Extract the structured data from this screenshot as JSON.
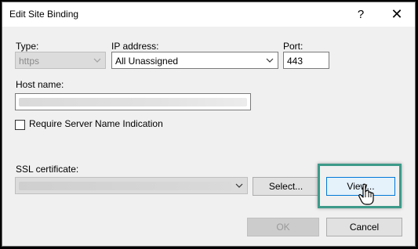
{
  "dialog": {
    "title": "Edit Site Binding",
    "help_label": "?",
    "close_label": "✕"
  },
  "type": {
    "label": "Type:",
    "value": "https"
  },
  "ip": {
    "label": "IP address:",
    "value": "All Unassigned"
  },
  "port": {
    "label": "Port:",
    "value": "443"
  },
  "host": {
    "label": "Host name:"
  },
  "sni": {
    "label": "Require Server Name Indication",
    "checked": false
  },
  "ssl": {
    "label": "SSL certificate:"
  },
  "buttons": {
    "select": "Select...",
    "view": "View...",
    "ok": "OK",
    "cancel": "Cancel"
  },
  "accent": {
    "focus_border": "#0078d7",
    "highlight": "#3d9a8a"
  }
}
